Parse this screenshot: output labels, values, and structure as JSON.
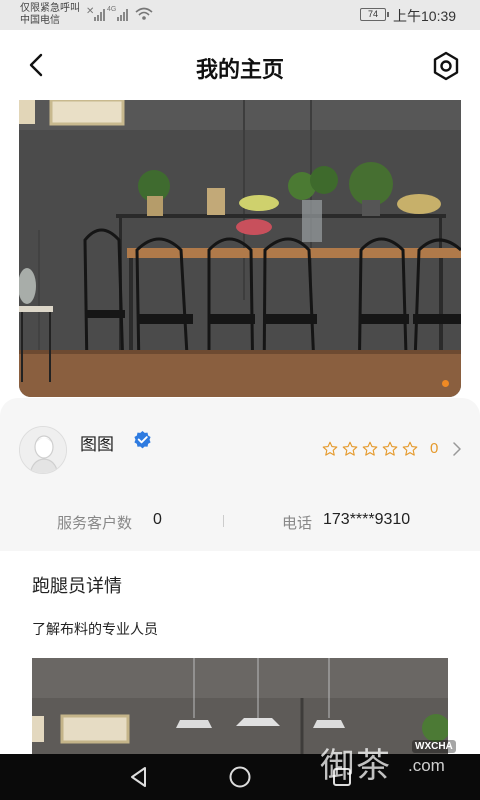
{
  "status_bar": {
    "carrier_line1": "仅限紧急呼叫",
    "carrier_line2": "中国电信",
    "signal_label": "4G",
    "battery": "74",
    "time": "上午10:39"
  },
  "header": {
    "title": "我的主页",
    "back_icon": "chevron-left-icon",
    "settings_icon": "hexagon-settings-icon"
  },
  "banner": {
    "image": "dining-room-photo",
    "pager_active_color": "#f08a24"
  },
  "profile": {
    "name": "图图",
    "verified_icon": "verified-badge-icon",
    "verified_color": "#2e7be0",
    "rating_stars_max": 5,
    "rating_stars_filled": 0,
    "rating_value": "0",
    "rating_color": "#e59a2d"
  },
  "stats": {
    "customers_label": "服务客户数",
    "customers_value": "0",
    "phone_label": "电话",
    "phone_value": "173****9310"
  },
  "details": {
    "section_title": "跑腿员详情",
    "description": "了解布料的专业人员"
  },
  "watermark": {
    "text": "御茶",
    "tag": "WXCHA",
    "suffix": ".com"
  },
  "nav_bar": {
    "back_icon": "triangle-back-icon",
    "home_icon": "circle-home-icon",
    "recents_icon": "square-recents-icon"
  }
}
